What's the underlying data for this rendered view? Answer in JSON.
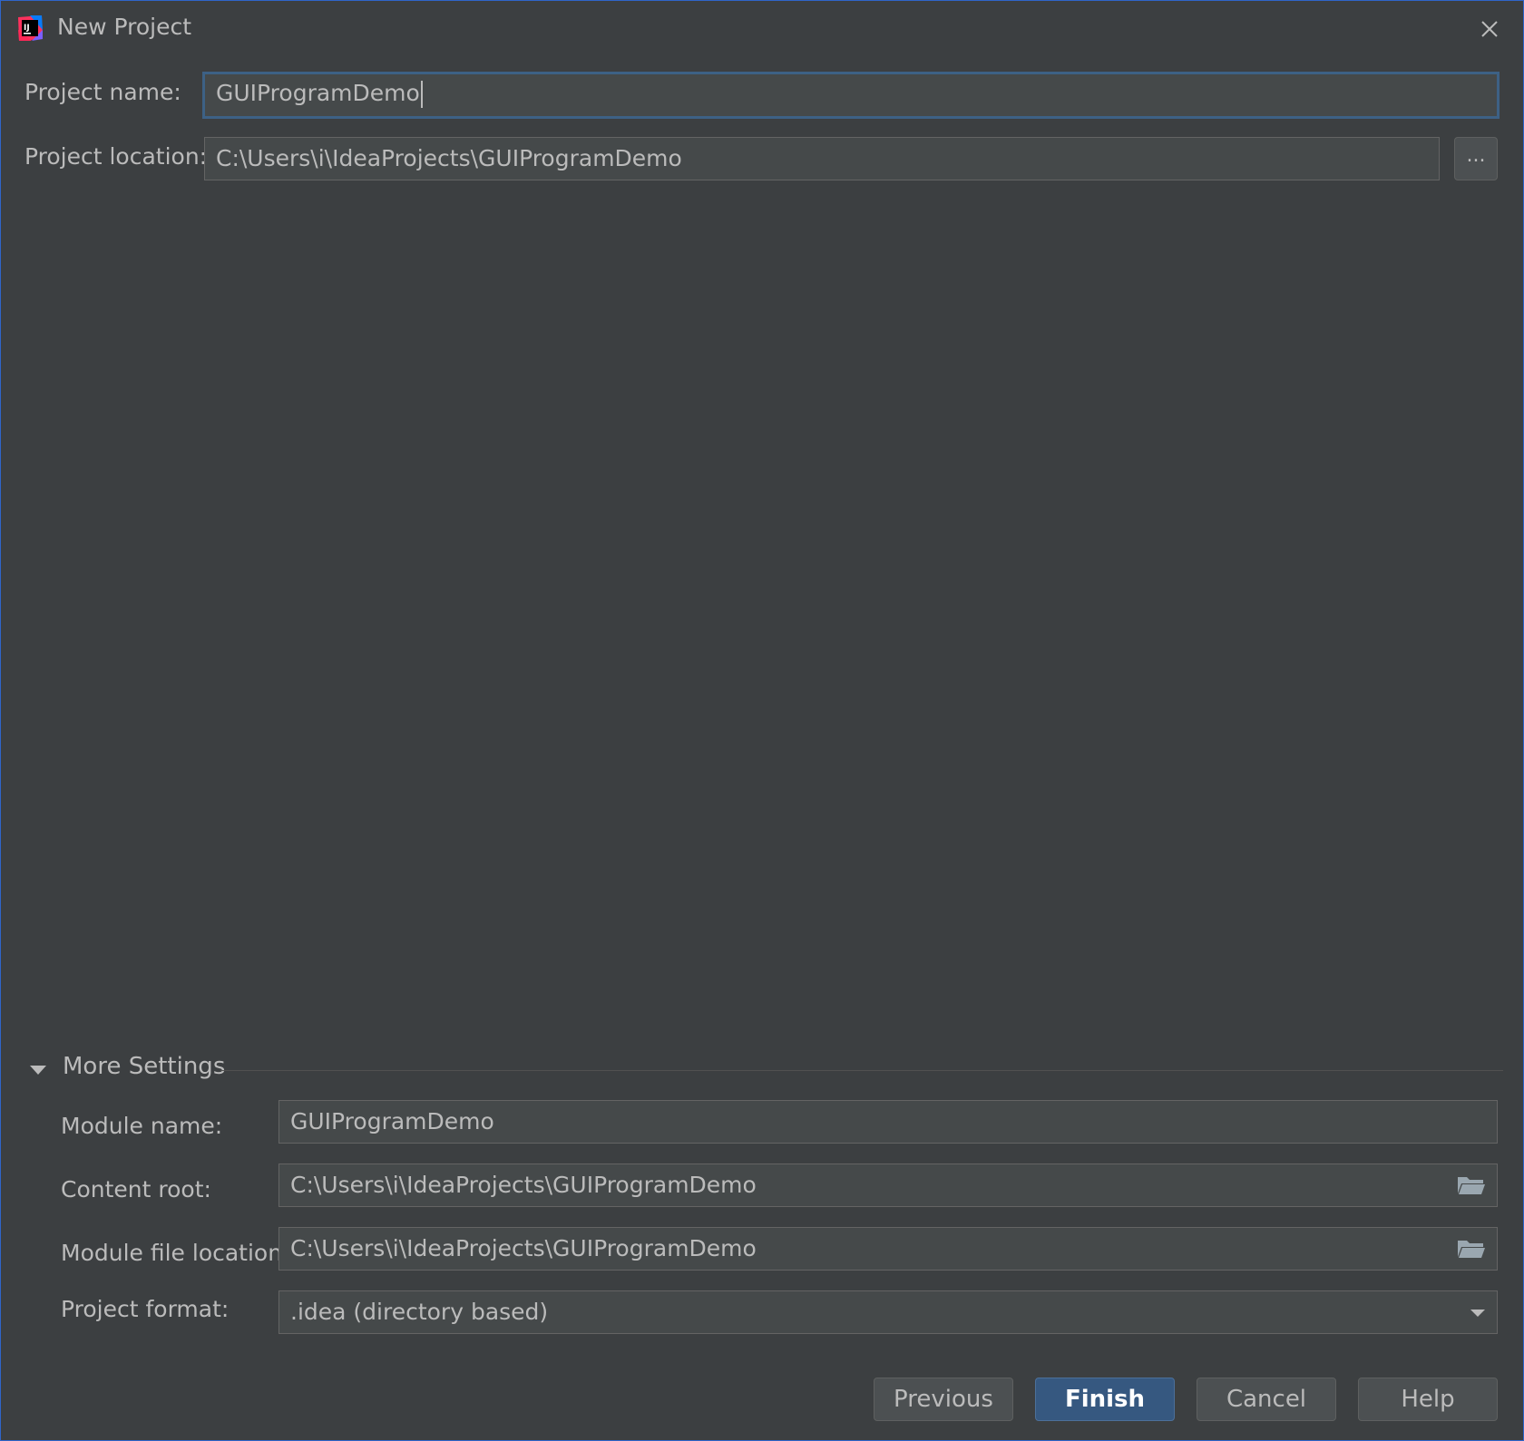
{
  "window": {
    "title": "New Project",
    "colors": {
      "accent": "#2f65ca",
      "background": "#3c3f41",
      "field_bg": "#45494a",
      "primary_button": "#365880"
    }
  },
  "form": {
    "project_name_label": "Project name:",
    "project_name_value": "GUIProgramDemo",
    "project_location_label": "Project location:",
    "project_location_value": "C:\\Users\\i\\IdeaProjects\\GUIProgramDemo",
    "browse_label": "..."
  },
  "more_settings": {
    "title": "More Settings",
    "expanded": true,
    "module_name_label": "Module name:",
    "module_name_value": "GUIProgramDemo",
    "content_root_label": "Content root:",
    "content_root_value": "C:\\Users\\i\\IdeaProjects\\GUIProgramDemo",
    "module_file_label": "Module file location:",
    "module_file_value": "C:\\Users\\i\\IdeaProjects\\GUIProgramDemo",
    "project_format_label": "Project format:",
    "project_format_value": ".idea (directory based)"
  },
  "buttons": {
    "previous": "Previous",
    "finish": "Finish",
    "cancel": "Cancel",
    "help": "Help"
  },
  "icons": {
    "app": "intellij-idea-icon",
    "close": "close-icon",
    "toggle": "triangle-down-icon",
    "folder": "folder-icon",
    "dropdown": "chevron-down-icon"
  }
}
